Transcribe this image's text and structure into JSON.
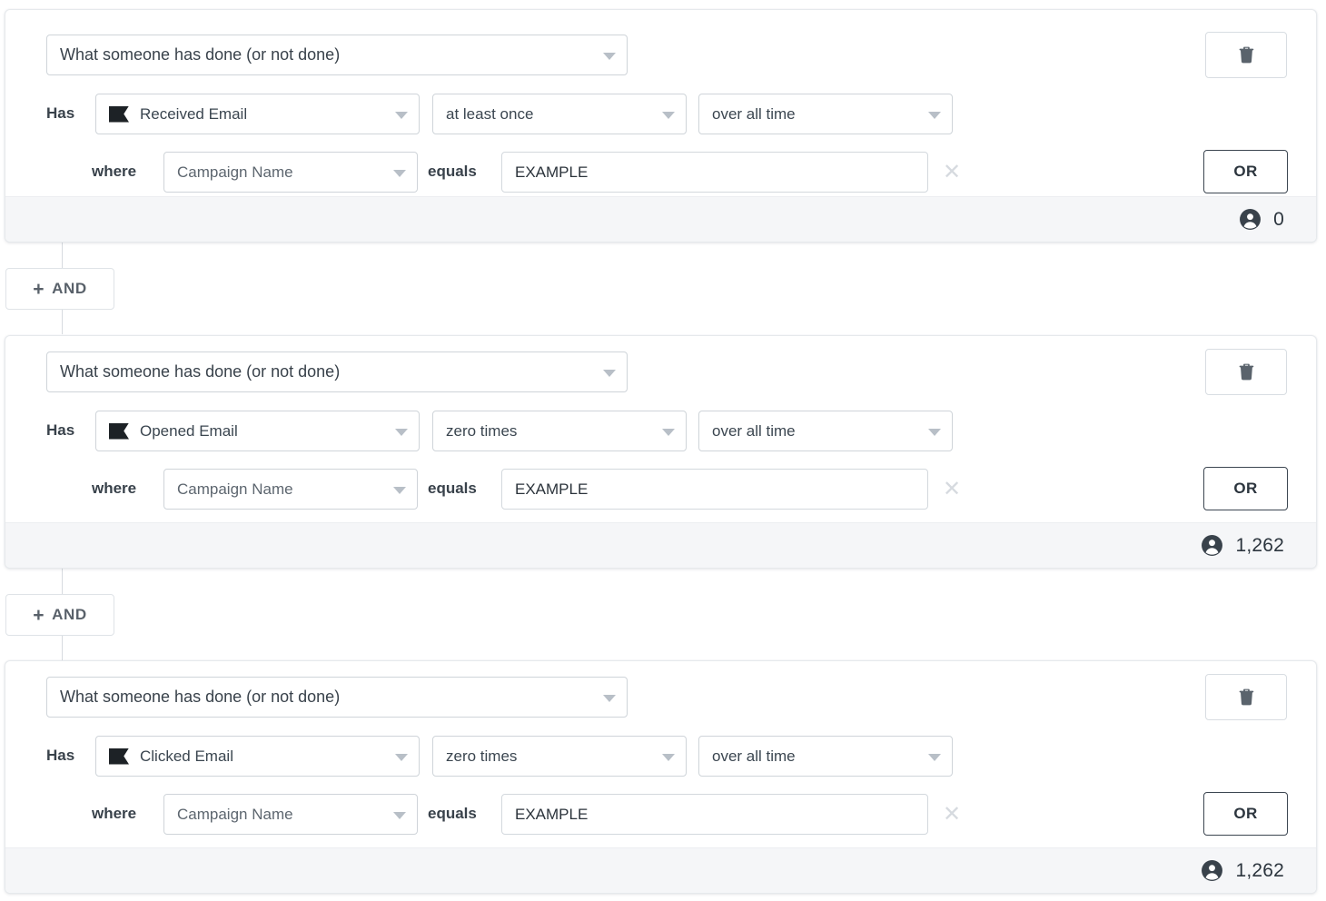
{
  "labels": {
    "has": "Has",
    "where": "where",
    "equals": "equals",
    "or": "OR",
    "and": "AND",
    "and_plus": "+"
  },
  "blocks": [
    {
      "type_select": "What someone has done (or not done)",
      "event": "Received Email",
      "event_icon": "flag-icon",
      "frequency": "at least once",
      "timeframe": "over all time",
      "attribute": "Campaign Name",
      "value": "EXAMPLE",
      "or_label": "OR",
      "count": "0",
      "count_icon": "person-icon",
      "delete_icon": "trash-icon"
    },
    {
      "type_select": "What someone has done (or not done)",
      "event": "Opened Email",
      "event_icon": "flag-icon",
      "frequency": "zero times",
      "timeframe": "over all time",
      "attribute": "Campaign Name",
      "value": "EXAMPLE",
      "or_label": "OR",
      "count": "1,262",
      "count_icon": "person-icon",
      "delete_icon": "trash-icon"
    },
    {
      "type_select": "What someone has done (or not done)",
      "event": "Clicked Email",
      "event_icon": "flag-icon",
      "frequency": "zero times",
      "timeframe": "over all time",
      "attribute": "Campaign Name",
      "value": "EXAMPLE",
      "or_label": "OR",
      "count": "1,262",
      "count_icon": "person-icon",
      "delete_icon": "trash-icon"
    }
  ],
  "colors": {
    "card_border": "#e6e9ec",
    "footer_bg": "#f5f6f8",
    "text": "#2f3a45",
    "caret": "#b8bfc7",
    "or_border": "#3c4651",
    "flag": "#1d2226"
  }
}
